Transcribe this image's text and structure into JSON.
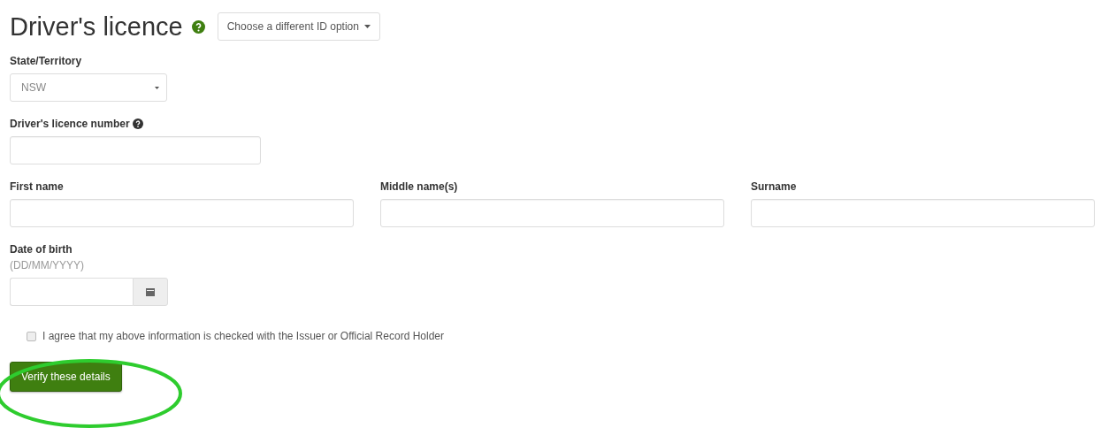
{
  "heading": {
    "title": "Driver's licence",
    "id_option_button": "Choose a different ID option"
  },
  "state_field": {
    "label": "State/Territory",
    "value": "NSW"
  },
  "licence_number_field": {
    "label": "Driver's licence number"
  },
  "name_fields": [
    {
      "label": "First name"
    },
    {
      "label": "Middle name(s)"
    },
    {
      "label": "Surname"
    }
  ],
  "date_of_birth_field": {
    "label": "Date of birth",
    "hint": "(DD/MM/YYYY)"
  },
  "consent": {
    "label": "I agree that my above information is checked with the Issuer or Official Record Holder",
    "checked": false
  },
  "submit_button": "Verify these details",
  "annotation": {
    "kind": "ellipse",
    "color": "#2ecc2e"
  }
}
